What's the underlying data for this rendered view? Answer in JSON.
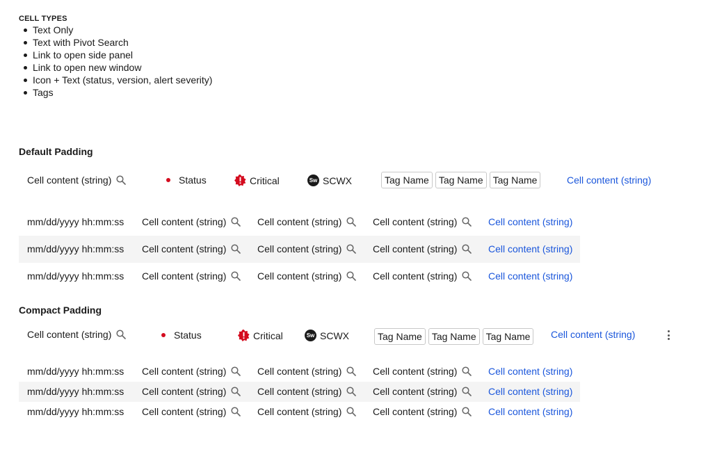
{
  "cell_types": {
    "title": "CELL TYPES",
    "items": [
      "Text Only",
      "Text with Pivot Search",
      "Link to open side panel",
      "Link to open new window",
      "Icon + Text (status, version, alert severity)",
      "Tags"
    ]
  },
  "default_padding": {
    "title": "Default Padding",
    "sample": {
      "text": "Cell content (string)",
      "status": "Status",
      "severity": "Critical",
      "customer": "SCWX",
      "customer_badge": "Sw",
      "tags": [
        "Tag Name",
        "Tag Name",
        "Tag Name"
      ],
      "link": "Cell content (string)"
    },
    "rows": [
      {
        "date": "mm/dd/yyyy hh:mm:ss",
        "c1": "Cell content (string)",
        "c2": "Cell content (string)",
        "c3": "Cell content (string)",
        "link": "Cell content (string)"
      },
      {
        "date": "mm/dd/yyyy hh:mm:ss",
        "c1": "Cell content (string)",
        "c2": "Cell content (string)",
        "c3": "Cell content (string)",
        "link": "Cell content (string)"
      },
      {
        "date": "mm/dd/yyyy hh:mm:ss",
        "c1": "Cell content (string)",
        "c2": "Cell content (string)",
        "c3": "Cell content (string)",
        "link": "Cell content (string)"
      }
    ]
  },
  "compact_padding": {
    "title": "Compact Padding",
    "sample": {
      "text": "Cell content (string)",
      "status": "Status",
      "severity": "Critical",
      "customer": "SCWX",
      "customer_badge": "Sw",
      "tags": [
        "Tag Name",
        "Tag Name",
        "Tag Name"
      ],
      "link": "Cell content (string)"
    },
    "rows": [
      {
        "date": "mm/dd/yyyy hh:mm:ss",
        "c1": "Cell content (string)",
        "c2": "Cell content (string)",
        "c3": "Cell content (string)",
        "link": "Cell content (string)"
      },
      {
        "date": "mm/dd/yyyy hh:mm:ss",
        "c1": "Cell content (string)",
        "c2": "Cell content (string)",
        "c3": "Cell content (string)",
        "link": "Cell content (string)"
      },
      {
        "date": "mm/dd/yyyy hh:mm:ss",
        "c1": "Cell content (string)",
        "c2": "Cell content (string)",
        "c3": "Cell content (string)",
        "link": "Cell content (string)"
      }
    ]
  },
  "icons": {
    "search": "search-icon",
    "status": "status-dot-icon",
    "severity": "critical-severity-icon",
    "customer": "customer-badge-icon",
    "more": "more-vertical-icon"
  },
  "colors": {
    "link": "#1a56db",
    "status_red": "#d40c1f",
    "stripe": "#f4f4f4",
    "tag_border": "#c8c8c8"
  }
}
